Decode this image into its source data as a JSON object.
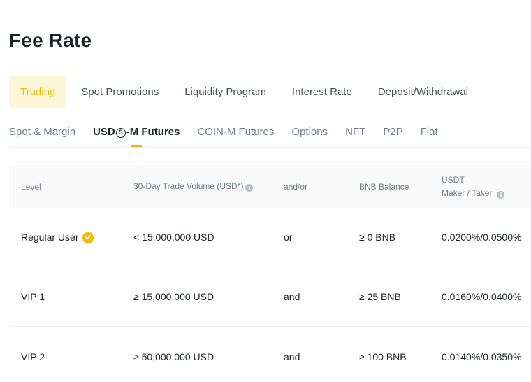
{
  "page": {
    "title": "Fee Rate"
  },
  "main_tabs": [
    {
      "label": "Trading",
      "active": true
    },
    {
      "label": "Spot Promotions",
      "active": false
    },
    {
      "label": "Liquidity Program",
      "active": false
    },
    {
      "label": "Interest Rate",
      "active": false
    },
    {
      "label": "Deposit/Withdrawal",
      "active": false
    }
  ],
  "sub_tabs": [
    {
      "label": "Spot & Margin",
      "active": false
    },
    {
      "label_prefix": "USD",
      "label_symbol": "S",
      "label_suffix": "-M Futures",
      "active": true
    },
    {
      "label": "COIN-M Futures",
      "active": false
    },
    {
      "label": "Options",
      "active": false
    },
    {
      "label": "NFT",
      "active": false
    },
    {
      "label": "P2P",
      "active": false
    },
    {
      "label": "Fiat",
      "active": false
    }
  ],
  "table": {
    "headers": {
      "level": "Level",
      "volume": "30-Day Trade Volume (USD*)",
      "andor": "and/or",
      "bnb": "BNB Balance",
      "fee_line1": "USDT",
      "fee_line2": "Maker / Taker"
    },
    "rows": [
      {
        "level": "Regular User",
        "volume": "< 15,000,000 USD",
        "andor": "or",
        "bnb": "≥ 0 BNB",
        "fee": "0.0200%/0.0500%"
      },
      {
        "level": "VIP 1",
        "volume": "≥ 15,000,000 USD",
        "andor": "and",
        "bnb": "≥ 25 BNB",
        "fee": "0.0160%/0.0400%"
      },
      {
        "level": "VIP 2",
        "volume": "≥ 50,000,000 USD",
        "andor": "and",
        "bnb": "≥ 100 BNB",
        "fee": "0.0140%/0.0350%"
      }
    ]
  },
  "colors": {
    "accent": "#f0b90b",
    "accent_bg": "#fef6d8",
    "text": "#1e2329",
    "muted": "#707a8a"
  },
  "icons": {
    "info": "info-icon",
    "badge": "verified-badge-icon"
  }
}
